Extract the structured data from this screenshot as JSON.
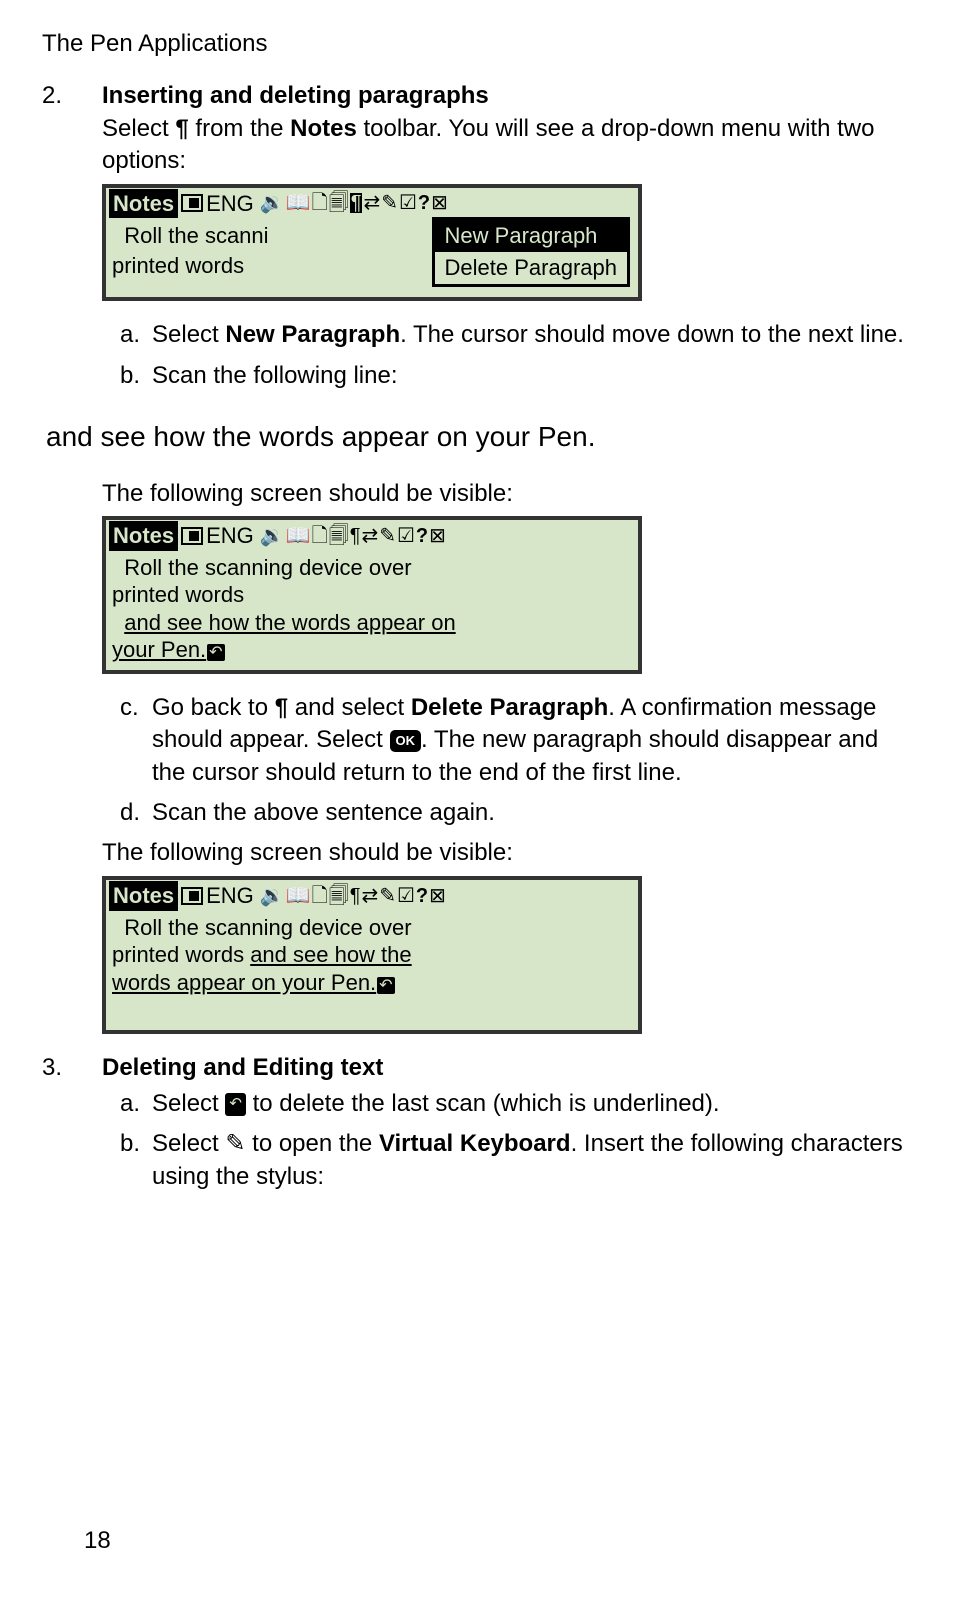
{
  "header": "The Pen Applications",
  "section2": {
    "num": "2.",
    "title": "Inserting and deleting paragraphs",
    "intro_pre": "Select ",
    "intro_mid": " from the ",
    "intro_notes": "Notes",
    "intro_post": " toolbar. You will see a drop-down menu with two options:",
    "ss1": {
      "label": "Notes",
      "lang": "ENG",
      "body_line1": "Roll the scanni",
      "body_line2": "printed words",
      "dropdown": {
        "item1": "New Paragraph",
        "item2": "Delete Paragraph"
      }
    },
    "a": {
      "letter": "a.",
      "pre": "Select ",
      "bold": "New Paragraph",
      "post": ". The cursor should move down to the next line."
    },
    "b": {
      "letter": "b.",
      "text": "Scan the following line:"
    },
    "scan_line": "and see how the words appear on your Pen.",
    "caption1": "The following screen should be visible:",
    "ss2": {
      "label": "Notes",
      "lang": "ENG",
      "line1": "Roll the scanning device over",
      "line2": "printed words",
      "line3": "and see how the words appear on",
      "line4": "your Pen."
    },
    "c": {
      "letter": "c.",
      "pre": "Go back to ",
      "mid": " and select ",
      "bold": "Delete Paragraph",
      "after_bold": ". A confirmation message should appear. Select ",
      "post": ". The new paragraph should disappear and the cursor should return to the end of the first line."
    },
    "d": {
      "letter": "d.",
      "text": "Scan the above sentence again."
    },
    "caption2": "The following screen should be visible:",
    "ss3": {
      "label": "Notes",
      "lang": "ENG",
      "line1": "Roll the scanning device over",
      "line2_pre": "printed words ",
      "line2_u": "and see how the",
      "line3_u": "words appear on your Pen."
    }
  },
  "section3": {
    "num": "3.",
    "title": "Deleting and Editing text",
    "a": {
      "letter": "a.",
      "pre": "Select ",
      "post": " to delete the last scan (which is underlined)."
    },
    "b": {
      "letter": "b.",
      "pre": "Select ",
      "mid": " to open the ",
      "bold": "Virtual Keyboard",
      "post": ". Insert the following characters using the stylus:"
    }
  },
  "page_number": "18"
}
